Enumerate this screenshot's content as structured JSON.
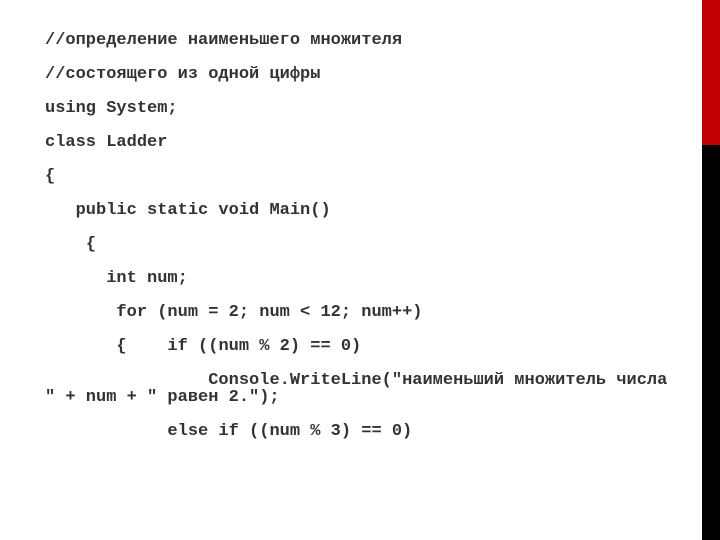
{
  "code": {
    "line1": "//определение наименьшего множителя",
    "line2": "//состоящего из одной цифры",
    "line3": "using System;",
    "line4": "class Ladder",
    "line5": "{",
    "line6": "   public static void Main()",
    "line7": "    {",
    "line8": "      int num;",
    "line9": "       for (num = 2; num < 12; num++)",
    "line10": "       {    if ((num % 2) == 0)",
    "line11": "                Console.WriteLine(\"наименьший множитель числа \" + num + \" равен 2.\");",
    "line12": "            else if ((num % 3) == 0)"
  }
}
